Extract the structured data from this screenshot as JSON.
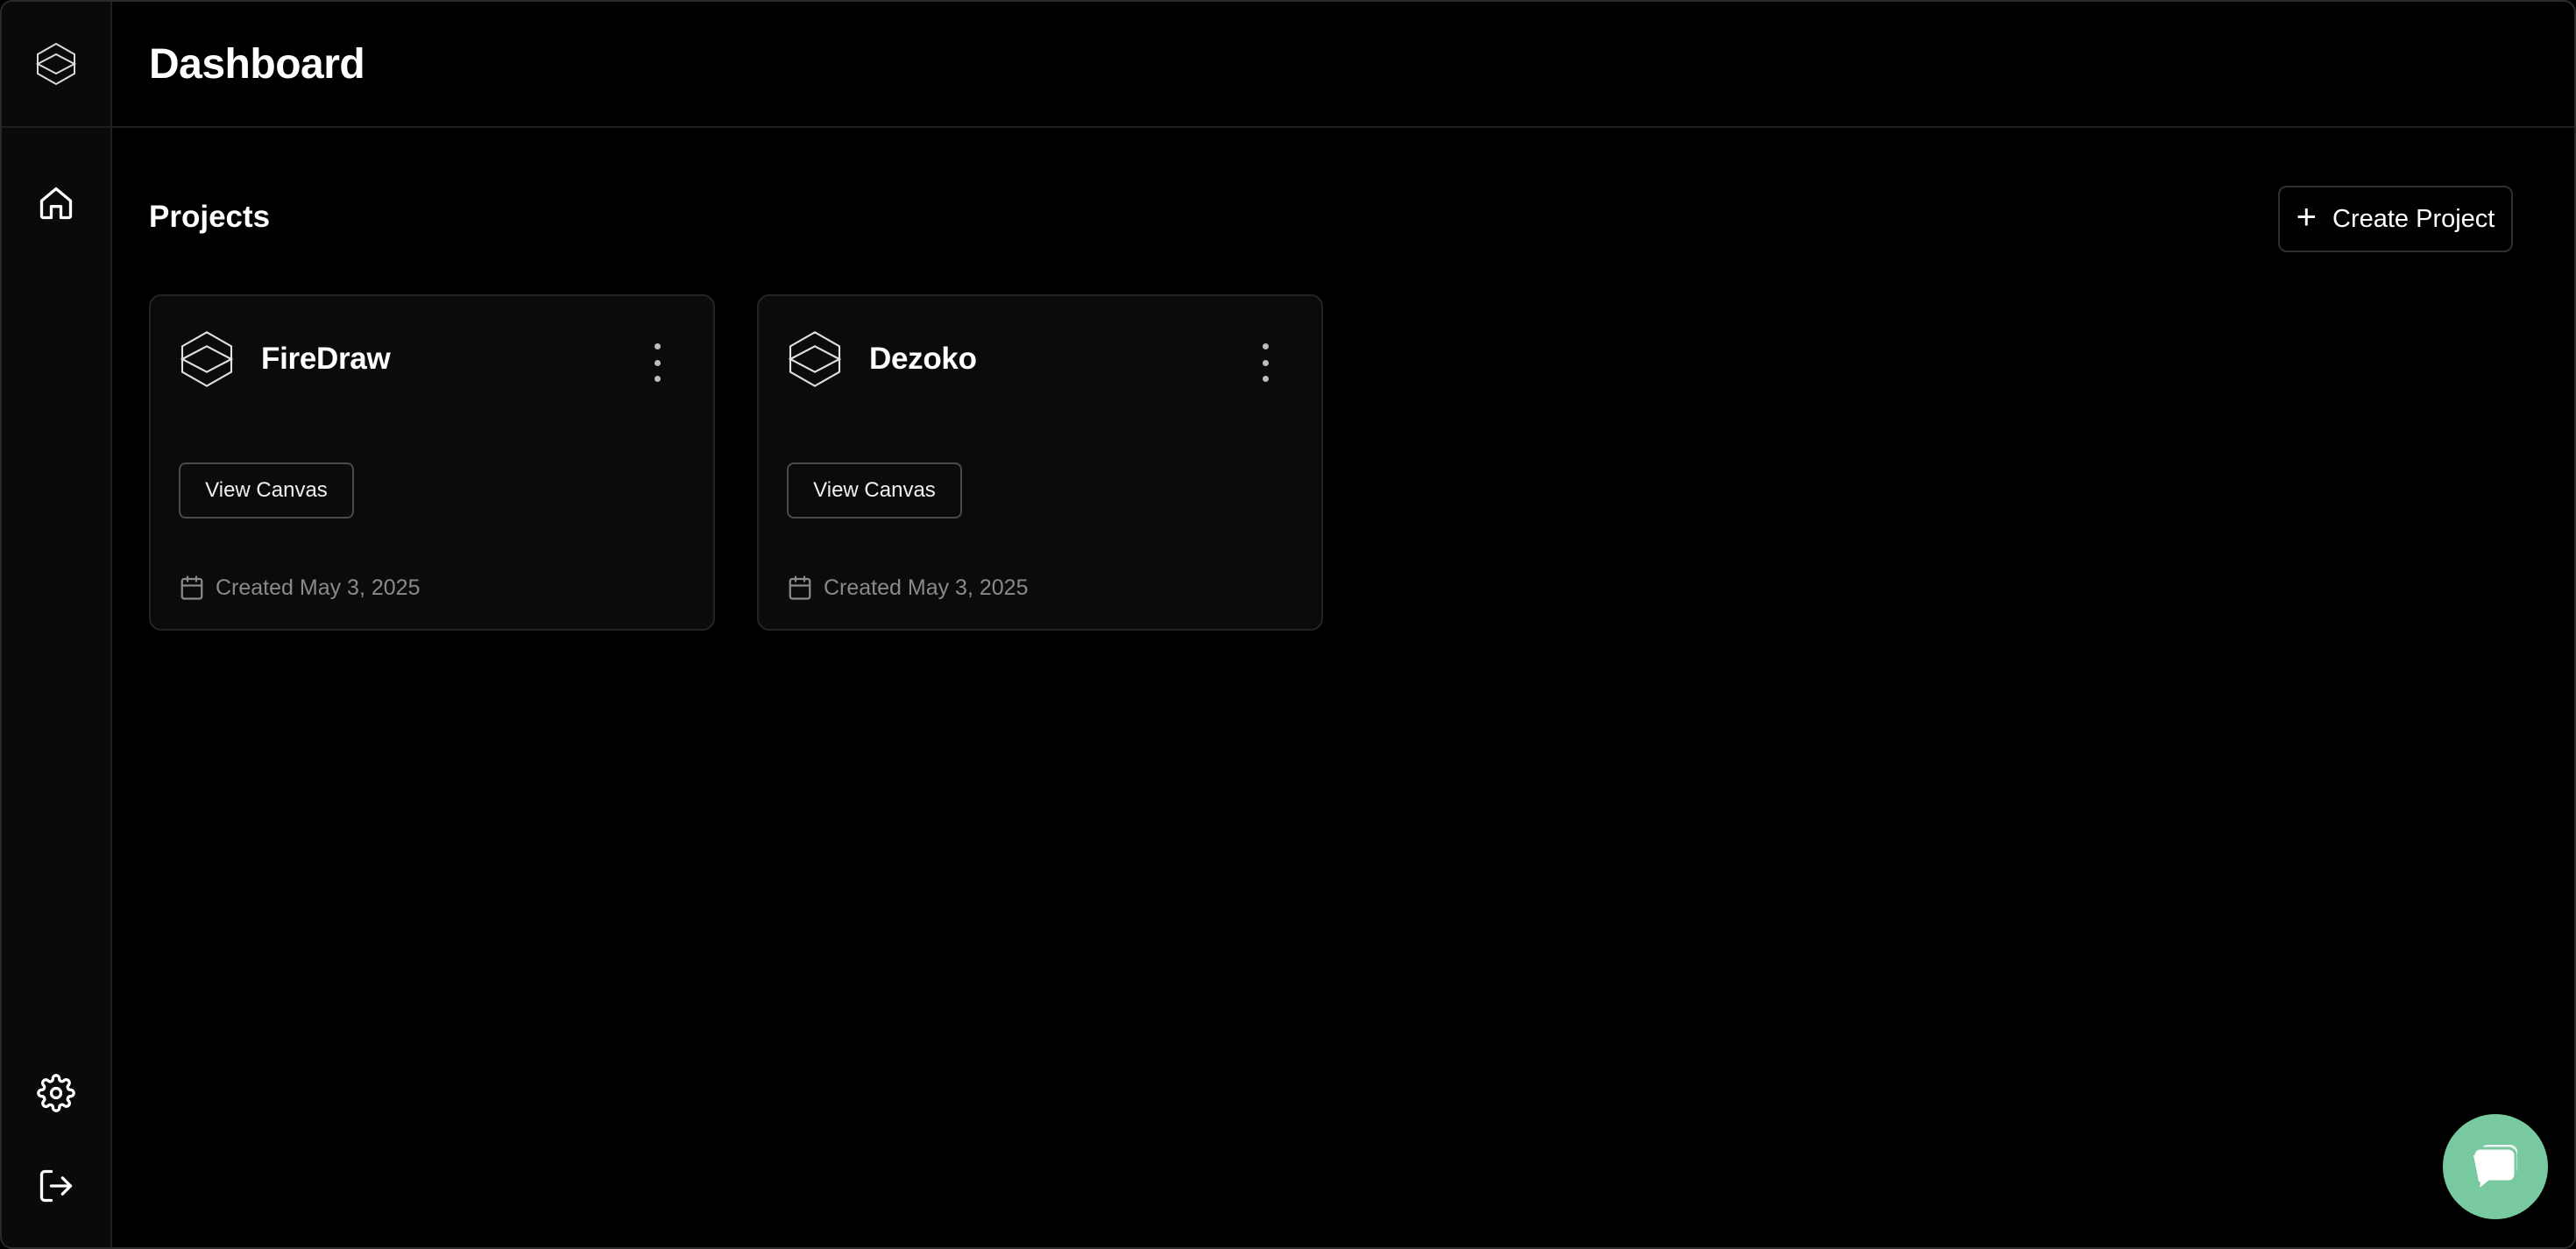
{
  "header": {
    "title": "Dashboard"
  },
  "projects": {
    "title": "Projects",
    "create_label": "Create Project",
    "items": [
      {
        "name": "FireDraw",
        "button_label": "View Canvas",
        "created": "Created May 3, 2025"
      },
      {
        "name": "Dezoko",
        "button_label": "View Canvas",
        "created": "Created May 3, 2025"
      }
    ]
  },
  "icons": {
    "logo": "layers-logo-icon",
    "home": "home-icon",
    "settings": "gear-icon",
    "logout": "logout-icon",
    "menu": "more-vertical-icon",
    "calendar": "calendar-icon",
    "chat": "chat-icon"
  },
  "colors": {
    "background": "#000000",
    "chat_accent": "#78c8a0"
  }
}
